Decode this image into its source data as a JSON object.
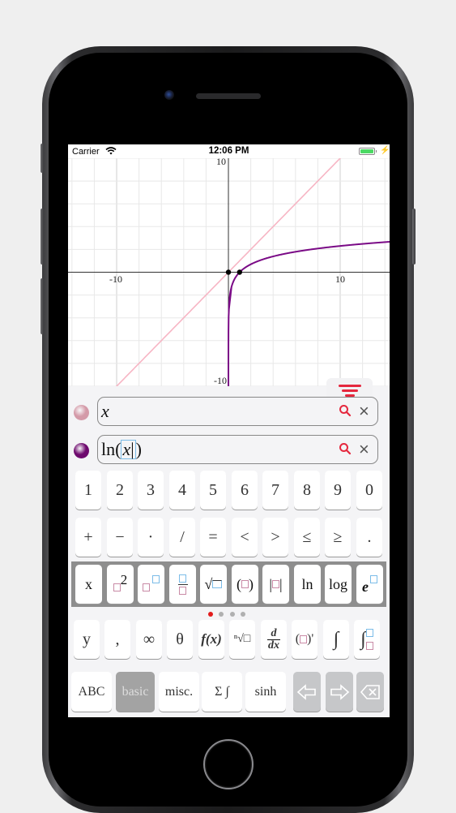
{
  "status_bar": {
    "carrier": "Carrier",
    "time": "12:06 PM",
    "battery_level_percent": 100,
    "charging": true
  },
  "graph": {
    "x_range": [
      -14.35,
      14.42
    ],
    "y_range": [
      -10,
      10
    ],
    "grid_step": 2,
    "axis_labels": {
      "x_neg": "-10",
      "x_pos": "10",
      "y_pos": "10",
      "y_neg": "-10"
    },
    "curves": [
      {
        "expression": "x",
        "color": "#f7b5c4"
      },
      {
        "expression": "ln(x)",
        "color": "#7a0a86"
      }
    ],
    "marked_points": [
      {
        "x": 0,
        "y": 0
      },
      {
        "x": 1,
        "y": 0
      }
    ],
    "filter_icon": "filter-icon",
    "filter_color": "#e5283e"
  },
  "expressions": [
    {
      "dot_color": "#d49aa8",
      "text": "x",
      "active": false
    },
    {
      "dot_color": "#6e0a6e",
      "prefix": "ln(",
      "var": "x",
      "suffix": ")",
      "active": true
    }
  ],
  "keyboard": {
    "row_numbers": [
      "1",
      "2",
      "3",
      "4",
      "5",
      "6",
      "7",
      "8",
      "9",
      "0"
    ],
    "row_operators": [
      "+",
      "−",
      "·",
      "/",
      "=",
      "<",
      ">",
      "≤",
      "≥",
      "."
    ],
    "row_functions": [
      "x",
      "□²",
      "□^□",
      "□/□",
      "√□",
      "(□)",
      "|□|",
      "ln",
      "log",
      "e^□"
    ],
    "page_count": 4,
    "active_page": 0,
    "row_advanced": [
      "y",
      ",",
      "∞",
      "θ",
      "f(x)",
      "ⁿ√□",
      "d/dx",
      "(□)'",
      "∫",
      "∫□□"
    ],
    "bottom_row": [
      "ABC",
      "basic",
      "misc.",
      "Σ ∫",
      "sinh"
    ],
    "active_tab": "basic",
    "action_keys": [
      "arrow-left",
      "arrow-right",
      "backspace"
    ]
  }
}
